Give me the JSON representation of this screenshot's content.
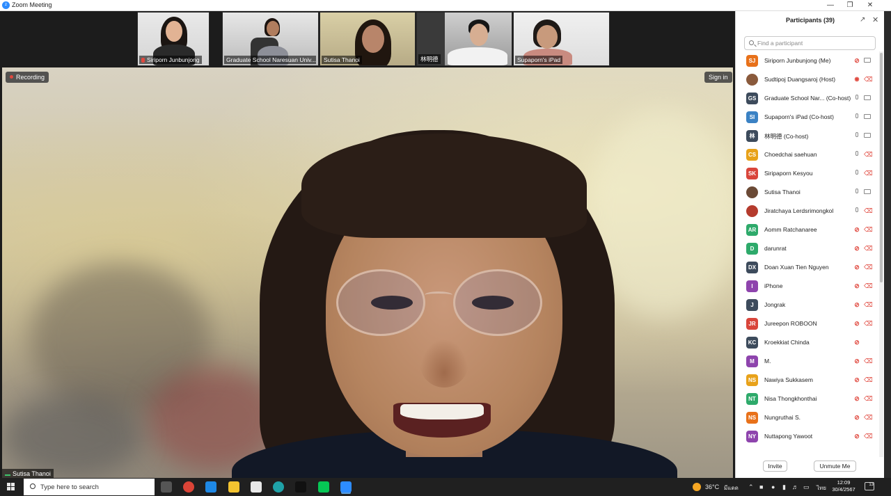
{
  "window": {
    "title": "Zoom Meeting"
  },
  "gallery": [
    {
      "name": "Siriporn Junbunjong",
      "muted": true
    },
    {
      "name": "Graduate School Naresuan Univ...",
      "muted": false
    },
    {
      "name": "Sutisa Thanoi",
      "muted": false
    },
    {
      "name": "林明德",
      "muted": false
    },
    {
      "name": "Supaporn's iPad",
      "muted": false
    }
  ],
  "main_video": {
    "recording_label": "Recording",
    "sign_in_label": "Sign in",
    "speaker_name": "Sutisa Thanoi"
  },
  "participants": {
    "title": "Participants (39)",
    "search_placeholder": "Find a participant",
    "invite_label": "Invite",
    "unmute_label": "Unmute Me",
    "list": [
      {
        "initials": "SJ",
        "name": "Siriporn Junbunjong (Me)",
        "color": "#e8711a",
        "photo": false,
        "mic": "off",
        "cam": "on"
      },
      {
        "initials": "",
        "name": "Sudtipoj Duangsaroj (Host)",
        "color": "#8a5a3c",
        "photo": true,
        "mic": "active",
        "cam": "off"
      },
      {
        "initials": "GS",
        "name": "Graduate School Nar... (Co-host)",
        "color": "#3d4b5c",
        "photo": false,
        "mic": "on",
        "cam": "on"
      },
      {
        "initials": "SI",
        "name": "Supaporn's iPad (Co-host)",
        "color": "#3b82c4",
        "photo": false,
        "mic": "on",
        "cam": "on"
      },
      {
        "initials": "林",
        "name": "林明德 (Co-host)",
        "color": "#3d4b5c",
        "photo": false,
        "mic": "on",
        "cam": "on"
      },
      {
        "initials": "CS",
        "name": "Choedchai saehuan",
        "color": "#e8a21a",
        "photo": false,
        "mic": "on",
        "cam": "off"
      },
      {
        "initials": "SK",
        "name": "Siripaporn Kesyou",
        "color": "#d9453b",
        "photo": false,
        "mic": "on",
        "cam": "off"
      },
      {
        "initials": "",
        "name": "Sutisa Thanoi",
        "color": "#6b4a36",
        "photo": true,
        "mic": "on",
        "cam": "on"
      },
      {
        "initials": "",
        "name": "Jiratchaya Lerdsrimongkol",
        "color": "#b53b2d",
        "photo": true,
        "mic": "on",
        "cam": "off"
      },
      {
        "initials": "AR",
        "name": "Aomm Ratchanaree",
        "color": "#2eaa6b",
        "photo": false,
        "mic": "off",
        "cam": "off"
      },
      {
        "initials": "D",
        "name": "darunrat",
        "color": "#2eaa6b",
        "photo": false,
        "mic": "off",
        "cam": "off"
      },
      {
        "initials": "DX",
        "name": "Doan Xuan Tien Nguyen",
        "color": "#3d4b5c",
        "photo": false,
        "mic": "off",
        "cam": "off"
      },
      {
        "initials": "I",
        "name": "iPhone",
        "color": "#8e44ad",
        "photo": false,
        "mic": "off",
        "cam": "off"
      },
      {
        "initials": "J",
        "name": "Jongrak",
        "color": "#3d4b5c",
        "photo": false,
        "mic": "off",
        "cam": "off"
      },
      {
        "initials": "JR",
        "name": "Jureepon ROBOON",
        "color": "#d9453b",
        "photo": false,
        "mic": "off",
        "cam": "off"
      },
      {
        "initials": "KC",
        "name": "Kroekkiat Chinda",
        "color": "#3d4b5c",
        "photo": false,
        "mic": "off",
        "cam": "none"
      },
      {
        "initials": "M",
        "name": "M.",
        "color": "#8e44ad",
        "photo": false,
        "mic": "off",
        "cam": "off"
      },
      {
        "initials": "NS",
        "name": "Nawiya Sukkasem",
        "color": "#e8a21a",
        "photo": false,
        "mic": "off",
        "cam": "off"
      },
      {
        "initials": "NT",
        "name": "Nisa Thongkhonthai",
        "color": "#2eaa6b",
        "photo": false,
        "mic": "off",
        "cam": "off"
      },
      {
        "initials": "NS",
        "name": "Nungruthai S.",
        "color": "#e8711a",
        "photo": false,
        "mic": "off",
        "cam": "off"
      },
      {
        "initials": "NY",
        "name": "Nuttapong Yawoot",
        "color": "#8e44ad",
        "photo": false,
        "mic": "off",
        "cam": "off"
      }
    ]
  },
  "taskbar": {
    "search_placeholder": "Type here to search",
    "weather": "36°C",
    "weather_desc": "มีแดด",
    "lang": "ไทย",
    "time": "12:09",
    "date": "30/4/2567",
    "notifications": "13",
    "apps": [
      {
        "name": "task-view",
        "color": "#555555"
      },
      {
        "name": "chrome",
        "color": "#db4437"
      },
      {
        "name": "mail",
        "color": "#1e88e5"
      },
      {
        "name": "file-explorer",
        "color": "#f4c430"
      },
      {
        "name": "store",
        "color": "#e8e8e8"
      },
      {
        "name": "edge",
        "color": "#1fa2a8"
      },
      {
        "name": "tiktok",
        "color": "#111111"
      },
      {
        "name": "line",
        "color": "#06c755"
      },
      {
        "name": "zoom",
        "color": "#2d8cff"
      }
    ]
  }
}
